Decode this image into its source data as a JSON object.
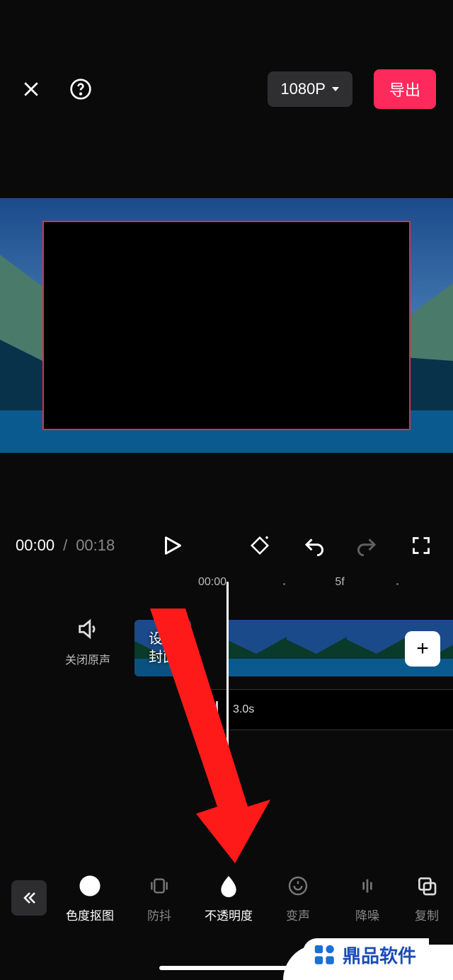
{
  "header": {
    "quality": "1080P",
    "export": "导出"
  },
  "playback": {
    "current": "00:00",
    "total": "00:18"
  },
  "ruler": {
    "t0": "00:00",
    "t5": "5f"
  },
  "timeline": {
    "mute_label": "关闭原声",
    "cover_label": "设置\n封面",
    "clip_duration": "3.0s"
  },
  "tools": {
    "collapse": "«",
    "items": [
      {
        "label": "色度抠图",
        "active": true
      },
      {
        "label": "防抖",
        "active": false
      },
      {
        "label": "不透明度",
        "active": true
      },
      {
        "label": "变声",
        "active": false
      },
      {
        "label": "降噪",
        "active": false
      },
      {
        "label": "复制",
        "active": false
      }
    ]
  },
  "watermark": "鼎品软件"
}
